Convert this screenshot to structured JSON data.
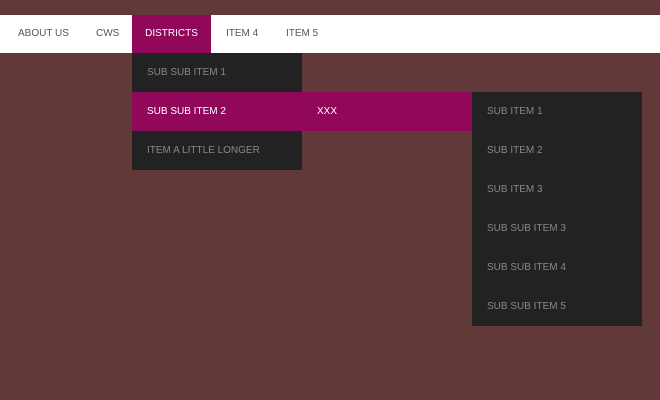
{
  "nav": {
    "items": [
      {
        "label": "ABOUT US"
      },
      {
        "label": "CWS"
      },
      {
        "label": "DISTRICTS",
        "active": true
      },
      {
        "label": "ITEM 4"
      },
      {
        "label": "ITEM 5"
      }
    ]
  },
  "dropdown": {
    "items": [
      {
        "label": "SUB SUB ITEM 1"
      },
      {
        "label": "SUB SUB ITEM 2",
        "active": true
      },
      {
        "label": "ITEM A LITTLE LONGER"
      }
    ]
  },
  "submenu": {
    "items": [
      {
        "label": "XXX",
        "active": true
      }
    ]
  },
  "flyout": {
    "items": [
      {
        "label": "SUB ITEM 1"
      },
      {
        "label": "SUB ITEM 2"
      },
      {
        "label": "SUB ITEM 3"
      },
      {
        "label": "SUB SUB ITEM 3"
      },
      {
        "label": "SUB SUB ITEM 4"
      },
      {
        "label": "SUB SUB ITEM 5"
      }
    ]
  },
  "colors": {
    "page_background": "#613939",
    "nav_background": "#ffffff",
    "accent": "#91075a",
    "menu_background": "#222222",
    "menu_text": "#888888"
  }
}
